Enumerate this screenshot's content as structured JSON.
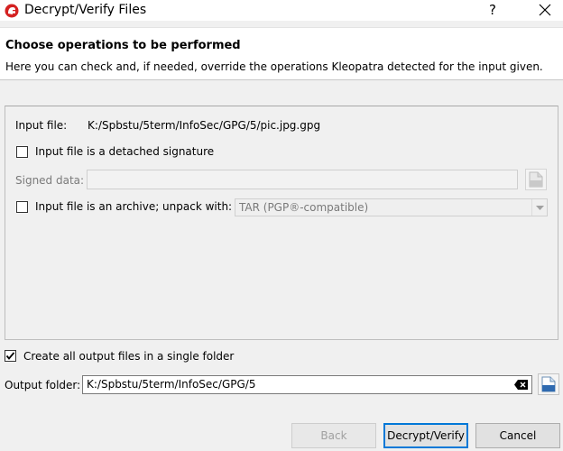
{
  "window": {
    "title": "Decrypt/Verify Files",
    "help_label": "?",
    "app_icon": "kleopatra-icon",
    "close_icon": "close-icon"
  },
  "header": {
    "title": "Choose operations to be performed",
    "subtitle": "Here you can check and, if needed, override the operations Kleopatra detected for the input given."
  },
  "input": {
    "file_label": "Input file:",
    "file_value": "K:/Spbstu/5term/InfoSec/GPG/5/pic.jpg.gpg",
    "detached_label": "Input file is a detached signature",
    "detached_checked": false,
    "signed_data_label": "Signed data:",
    "signed_data_value": "",
    "archive_label": "Input file is an archive; unpack with:",
    "archive_checked": false,
    "archive_option": "TAR (PGP®-compatible)"
  },
  "output": {
    "single_folder_label": "Create all output files in a single folder",
    "single_folder_checked": true,
    "folder_label": "Output folder:",
    "folder_value": "K:/Spbstu/5term/InfoSec/GPG/5"
  },
  "buttons": {
    "back": "Back",
    "decrypt_verify": "Decrypt/Verify",
    "cancel": "Cancel"
  },
  "colors": {
    "accent": "#0078d7",
    "title_bg": "#ffffff",
    "dialog_bg": "#f0f0f0"
  }
}
